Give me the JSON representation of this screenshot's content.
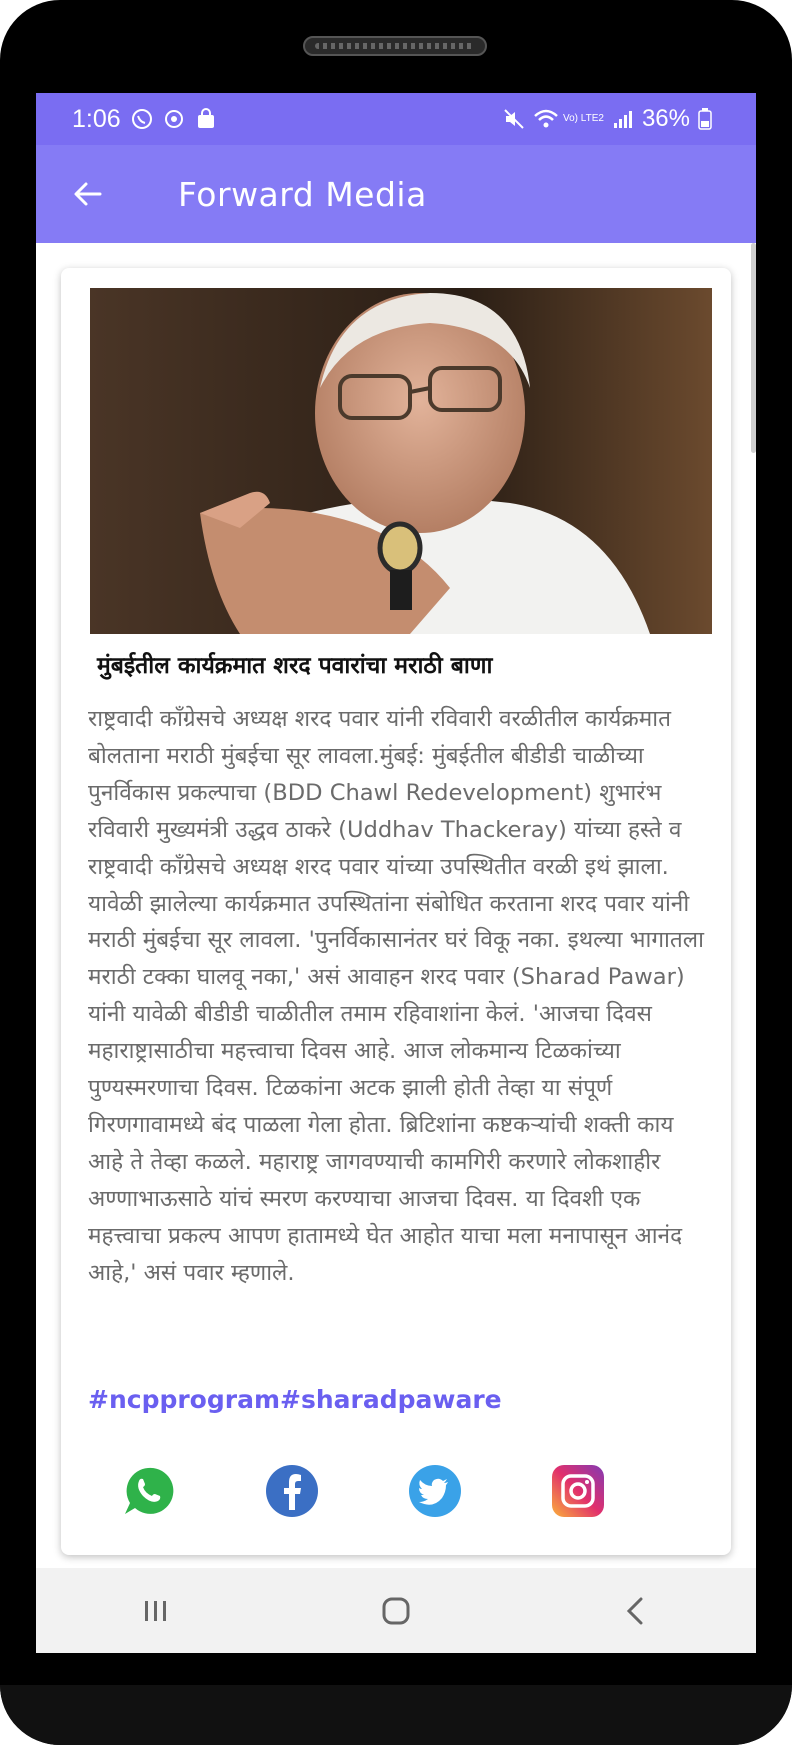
{
  "status_bar": {
    "time": "1:06",
    "battery": "36%",
    "network_label": "Vo) LTE2",
    "left_icons": [
      "viber-icon",
      "sync-icon",
      "bag-icon"
    ],
    "right_icons": [
      "mute-icon",
      "wifi-icon",
      "signal-icon",
      "battery-icon"
    ]
  },
  "app_bar": {
    "title": "Forward Media",
    "back_icon": "arrow-left-icon"
  },
  "post": {
    "image_description": "photo",
    "headline": "मुंबईतील कार्यक्रमात शरद पवारांचा मराठी बाणा",
    "body": "राष्ट्रवादी काँग्रेसचे अध्यक्ष शरद पवार यांनी रविवारी वरळीतील कार्यक्रमात बोलताना मराठी मुंबईचा सूर लावला.मुंबई: मुंबईतील बीडीडी चाळीच्या पुनर्विकास प्रकल्पाचा (BDD Chawl Redevelopment) शुभारंभ रविवारी मुख्यमंत्री उद्धव ठाकरे (Uddhav Thackeray) यांच्या हस्ते व राष्ट्रवादी काँग्रेसचे अध्यक्ष शरद पवार यांच्या उपस्थितीत वरळी इथं झाला. यावेळी झालेल्या कार्यक्रमात उपस्थितांना संबोधित करताना शरद पवार यांनी मराठी मुंबईचा सूर लावला. 'पुनर्विकासानंतर घरं विकू नका. इथल्या भागातला मराठी टक्का घालवू नका,' असं आवाहन शरद पवार (Sharad Pawar) यांनी यावेळी बीडीडी चाळीतील तमाम रहिवाशांना केलं. 'आजचा दिवस महाराष्ट्रासाठीचा महत्त्वाचा दिवस आहे. आज लोकमान्य टिळकांच्या पुण्यस्मरणाचा दिवस. टिळकांना अटक झाली होती तेव्हा या संपूर्ण गिरणगावामध्ये बंद पाळला गेला होता. ब्रिटिशांना कष्टकऱ्यांची शक्ती काय आहे ते तेव्हा कळले. महाराष्ट्र जागवण्याची कामगिरी करणारे लोकशाहीर अण्णाभाऊसाठे यांचं स्मरण करण्याचा आजचा दिवस. या दिवशी एक महत्त्वाचा प्रकल्प आपण हातामध्ये घेत आहोत याचा मला मनापासून आनंद आहे,' असं पवार म्हणाले.",
    "hashtags": "#ncpprogram#sharadpaware"
  },
  "share": [
    {
      "name": "whatsapp",
      "icon": "whatsapp-icon",
      "color": "#2fb24a"
    },
    {
      "name": "facebook",
      "icon": "facebook-icon",
      "color": "#3b6fc4"
    },
    {
      "name": "twitter",
      "icon": "twitter-icon",
      "color": "#3aa2e8"
    },
    {
      "name": "instagram",
      "icon": "instagram-icon",
      "color": "#d6336c"
    }
  ],
  "nav_bar": {
    "buttons": [
      "recents-icon",
      "home-icon",
      "back-icon"
    ]
  },
  "colors": {
    "status_bar": "#7a6df2",
    "app_bar": "#857bf5",
    "hashtag": "#6a5ff0",
    "body_text": "#6b6b6b"
  }
}
